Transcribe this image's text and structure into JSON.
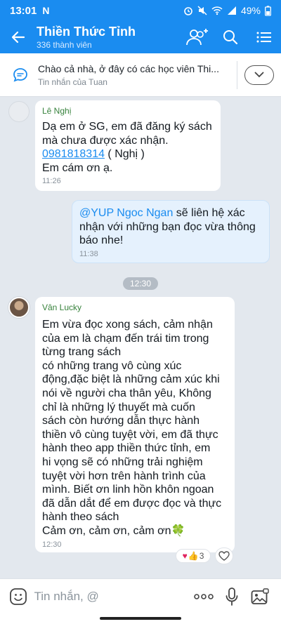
{
  "status_bar": {
    "time": "13:01",
    "app_logo": "N",
    "battery": "49%"
  },
  "header": {
    "title": "Thiền Thức Tỉnh",
    "member_count": "336 thành viên",
    "icons": [
      "back-arrow-icon",
      "add-member-icon",
      "search-icon",
      "menu-icon"
    ]
  },
  "pinned": {
    "message": "Chào cả nhà, ở đây có các học viên Thi...",
    "source": "Tin nhắn của Tuan"
  },
  "messages": [
    {
      "sender": "Lê Nghị",
      "line1": "Dạ em ở SG, em đã đăng ký sách",
      "line2": "mà chưa được xác nhận.",
      "phone": "0981818314",
      "phone_after": " ( Nghị )",
      "line4": "Em cám ơn ạ.",
      "time": "11:26"
    },
    {
      "mention": "@YUP Ngoc Ngan",
      "text": " sẽ liên hệ xác nhận với những bạn đọc vừa thông báo nhe!",
      "time": "11:38"
    },
    {
      "sender": "Vân Lucky",
      "lines": [
        "Em vừa đọc xong sách, cảm nhận",
        "của em là chạm đến trái tim trong",
        "từng trang sách",
        "có những trang vô cùng xúc",
        "động,đặc biệt là những cảm xúc khi",
        "nói về người cha thân yêu, Không",
        "chỉ là những lý thuyết mà cuốn",
        "sách còn hướng dẫn thực hành",
        "thiền vô cùng tuyệt vời, em đã thực",
        "hành theo app thiền thức tỉnh, em",
        "hi vọng sẽ có những trải nghiệm",
        "tuyệt vời hơn trên hành trình của",
        "mình. Biết ơn linh hồn khôn ngoan",
        "đã dẫn dắt để em được đọc và thực",
        "hành theo sách",
        "Cảm ơn, cảm ơn, cảm ơn🍀"
      ],
      "time": "12:30",
      "reaction_count": "3"
    }
  ],
  "time_divider": "12:30",
  "composer": {
    "placeholder": "Tin nhắn, @"
  },
  "colors": {
    "accent": "#1a8cf0",
    "sender_name": "#37823c",
    "chat_bg": "#e3e8ee"
  }
}
